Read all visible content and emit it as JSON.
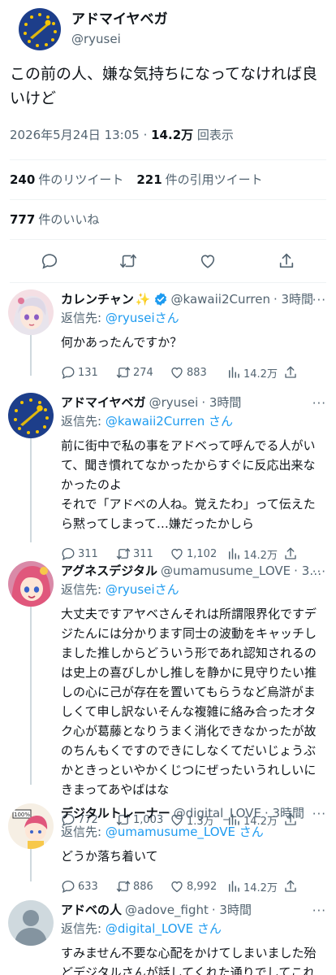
{
  "main": {
    "name": "アドマイヤベガ",
    "handle": "@ryusei",
    "text": "この前の人、嫌な気持ちになってなければ良いけど",
    "date": "2026年5月24日 13:05",
    "separator": " · ",
    "views_count": "14.2万",
    "views_label": "回表示",
    "retweets_count": "240",
    "retweets_label": "件のリツイート",
    "quotes_count": "221",
    "quotes_label": "件の引用ツイート",
    "likes_count": "777",
    "likes_label": "件のいいね",
    "icons": [
      "reply-icon",
      "retweet-icon",
      "like-icon",
      "share-icon"
    ]
  },
  "replies": [
    {
      "name": "カレンチャン",
      "name_emoji": "✨",
      "verified": true,
      "handle": "@kawaii2Curren",
      "time": "· 3時間",
      "menu": "···",
      "reply_prefix": "返信先:",
      "reply_to": "@ryuseiさん",
      "text": "何かあったんですか？",
      "replies": "131",
      "retweets": "274",
      "likes": "883",
      "views": "14.2万"
    },
    {
      "name": "アドマイヤベガ",
      "handle": "@ryusei",
      "time": "· 3時間",
      "menu": "···",
      "reply_prefix": "返信先:",
      "reply_to": "@kawaii2Curren さん",
      "text": "前に街中で私の事をアドベって呼んでる人がいて、聞き慣れてなかったからすぐに反応出来なかったのよ\nそれで「アドベの人ね。覚えたわ」って伝えたら黙ってしまって…嫌だったかしら",
      "replies": "311",
      "retweets": "311",
      "likes": "1,102",
      "views": "14.2万"
    },
    {
      "name": "アグネスデジタル",
      "handle": "@umamusume_LOVE",
      "time": "· 3…",
      "menu": "···",
      "reply_prefix": "返信先:",
      "reply_to": "@ryuseiさん",
      "text": "大丈夫ですアヤベさんそれは所謂限界化ですデジたんには分かります同士の波動をキャッチしました推しからどういう形であれ認知されるのは史上の喜びしかし推しを静かに見守りたい推しの心に己が存在を置いてもらうなど烏滸がましくて申し訳ないそんな複雑に絡み合ったオタク心が葛藤となりうまく消化できなかったが故のちんもくですのできにしなくてだいじょうぶかときっといやかくじつにぜったいうれしいにきまってあやばはな",
      "replies": "772",
      "retweets": "1,003",
      "likes": "1.3万",
      "views": "14.2万"
    },
    {
      "name": "デジタルトレーナー",
      "handle": "@digital_LOVE",
      "time": "· 3時間",
      "menu": "···",
      "reply_prefix": "返信先:",
      "reply_to": "@umamusume_LOVE さん",
      "text": "どうか落ち着いて",
      "replies": "633",
      "retweets": "886",
      "likes": "8,992",
      "views": "14.2万",
      "avatar_caption": "100%"
    },
    {
      "name": "アドベの人",
      "handle": "@adove_fight",
      "time": "· 3時間",
      "menu": "···",
      "reply_prefix": "返信先:",
      "reply_to": "@digital_LOVE さん",
      "text": "すみません不要な心配をかけてしまいました殆どデジタルさんが話してくれた通りでしてこれからも応援してます頑張ってください"
    }
  ],
  "colors": {
    "accent": "#1d9bf0",
    "muted": "#536471",
    "divider": "#eff3f4",
    "avatar_navy": "#1d3e8a",
    "star_yellow": "#f5c400"
  }
}
